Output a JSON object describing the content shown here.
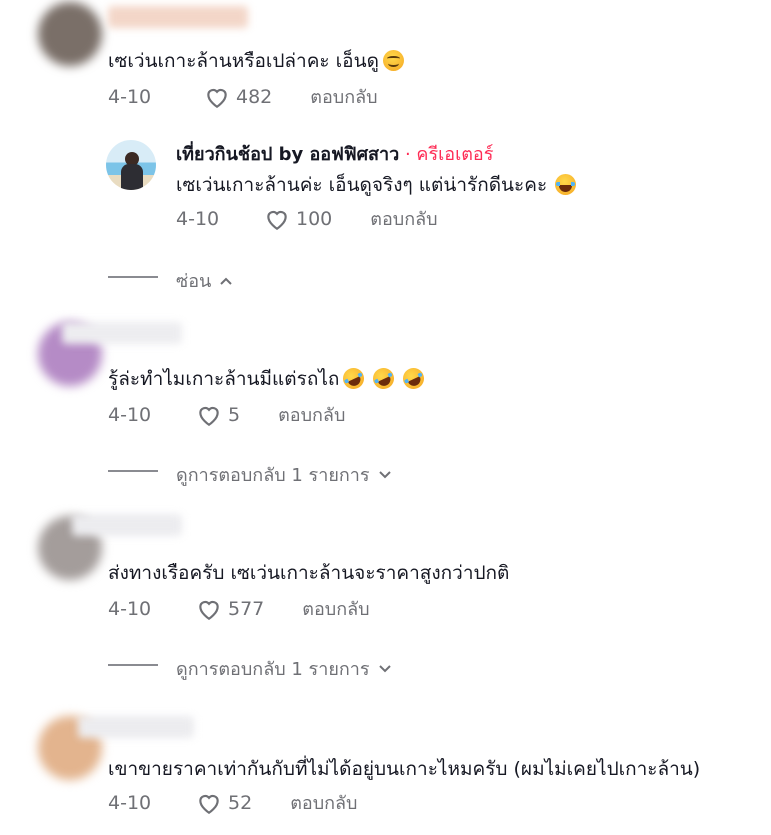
{
  "comments": [
    {
      "text": "เซเว่นเกาะล้านหรือเปล่าคะ เอ็นดู",
      "emoji": "smiling-face-icon",
      "date": "4-10",
      "likes": "482",
      "reply_label": "ตอบกลับ",
      "avatar_color": "#7a6f68",
      "reply": {
        "author": "เที่ยวกินช้อป by ออฟฟิศสาว",
        "badge": "· ครีเอเตอร์",
        "text": "เซเว่นเกาะล้านค่ะ เอ็นดูจริงๆ แต่น่ารักดีนะคะ",
        "emoji": "joy-icon",
        "date": "4-10",
        "likes": "100",
        "reply_label": "ตอบกลับ"
      },
      "toggle_label": "ซ่อน"
    },
    {
      "text": "รู้ล่ะทำไมเกาะล้านมีแต่รถไถ",
      "emoji": "rofl-icon",
      "date": "4-10",
      "likes": "5",
      "reply_label": "ตอบกลับ",
      "avatar_color": "#b58bc6",
      "view_replies": "ดูการตอบกลับ 1 รายการ"
    },
    {
      "text": "ส่งทางเรือครับ เซเว่นเกาะล้านจะราคาสูงกว่าปกติ",
      "date": "4-10",
      "likes": "577",
      "reply_label": "ตอบกลับ",
      "avatar_color": "#a49d9b",
      "view_replies": "ดูการตอบกลับ 1 รายการ"
    },
    {
      "text": "เขาขายราคาเท่ากันกับที่ไม่ได้อยู่บนเกาะไหมครับ (ผมไม่เคยไปเกาะล้าน)",
      "date": "4-10",
      "likes": "52",
      "reply_label": "ตอบกลับ",
      "avatar_color": "#e3b48e"
    }
  ],
  "colors": {
    "creator_accent": "#fe2c55",
    "meta_text": "#6f7075"
  }
}
